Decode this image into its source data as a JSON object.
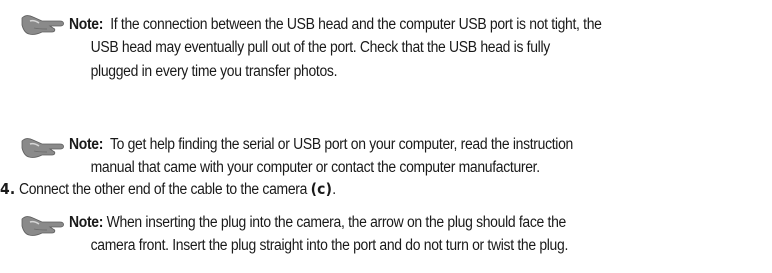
{
  "notes": [
    {
      "icon": "pointing-hand-icon",
      "label": "Note:",
      "lines": [
        "If the connection between the USB head and the computer USB port is not tight, the",
        "USB head may eventually pull out of the port. Check that the USB head is fully",
        "plugged in every time you transfer photos."
      ]
    },
    {
      "icon": "pointing-hand-icon",
      "label": "Note:",
      "lines": [
        "To get help finding the serial or USB port on your computer, read the instruction",
        "manual that came with your computer or contact the computer manufacturer."
      ]
    },
    {
      "icon": "pointing-hand-icon",
      "label": "Note:",
      "lines": [
        "When inserting the plug into the camera, the arrow on the plug should face the",
        "camera front. Insert the plug straight into the port and do not turn or twist the plug."
      ]
    }
  ],
  "step": {
    "number": "4.",
    "text": "Connect the other end of the cable to the camera",
    "ref": "(c)",
    "end": "."
  }
}
